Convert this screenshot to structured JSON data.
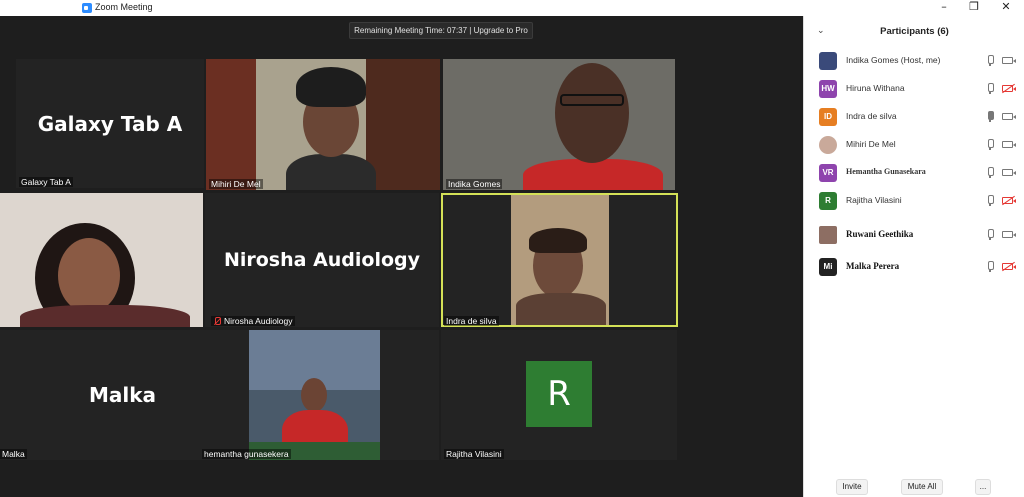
{
  "window": {
    "title": "Zoom Meeting",
    "minimize_glyph": "–",
    "restore_glyph": "❐",
    "close_glyph": "✕"
  },
  "meeting": {
    "banner": "Remaining Meeting Time: 07:37 | Upgrade to Pro"
  },
  "tiles": [
    {
      "big_text": "Galaxy Tab A",
      "name": "Galaxy Tab A"
    },
    {
      "big_text": "",
      "name": "Mihiri De Mel"
    },
    {
      "big_text": "",
      "name": "Indika Gomes"
    },
    {
      "big_text": "",
      "name": ""
    },
    {
      "big_text": "Nirosha Audiology",
      "name": "Nirosha Audiology"
    },
    {
      "big_text": "",
      "name": "Indra de silva"
    },
    {
      "big_text": "Malka",
      "name": "Malka"
    },
    {
      "big_text": "",
      "name": "hemantha gunasekera"
    },
    {
      "big_text": "R",
      "name": "Rajitha Vilasini"
    }
  ],
  "participants_panel": {
    "chevron": "⌄",
    "title": "Participants (6)",
    "items": [
      {
        "avatar": "",
        "avatar_color": "#3a4a7a",
        "name": "Indika Gomes (Host, me)",
        "style": "normal",
        "video_off": false
      },
      {
        "avatar": "HW",
        "avatar_color": "#8e44ad",
        "name": "Hiruna Withana",
        "style": "normal",
        "video_off": true
      },
      {
        "avatar": "ID",
        "avatar_color": "#e67e22",
        "name": "Indra de silva",
        "style": "normal",
        "video_off": false
      },
      {
        "avatar": "",
        "avatar_color": "#c9a99a",
        "name": "Mihiri De Mel",
        "style": "normal",
        "video_off": false
      },
      {
        "avatar": "VR",
        "avatar_color": "#8e44ad",
        "name": "Hemantha Gunasekara",
        "style": "serif-small",
        "video_off": false
      },
      {
        "avatar": "R",
        "avatar_color": "#2e7d32",
        "name": "Rajitha Vilasini",
        "style": "normal",
        "video_off": true
      },
      {
        "avatar": "",
        "avatar_color": "#8d6e63",
        "name": "Ruwani Geethika",
        "style": "serif",
        "video_off": false
      },
      {
        "avatar": "Mi",
        "avatar_color": "#222222",
        "name": "Malka Perera",
        "style": "serif",
        "video_off": true
      }
    ],
    "buttons": {
      "invite": "Invite",
      "mute_all": "Mute All",
      "more": "..."
    }
  }
}
